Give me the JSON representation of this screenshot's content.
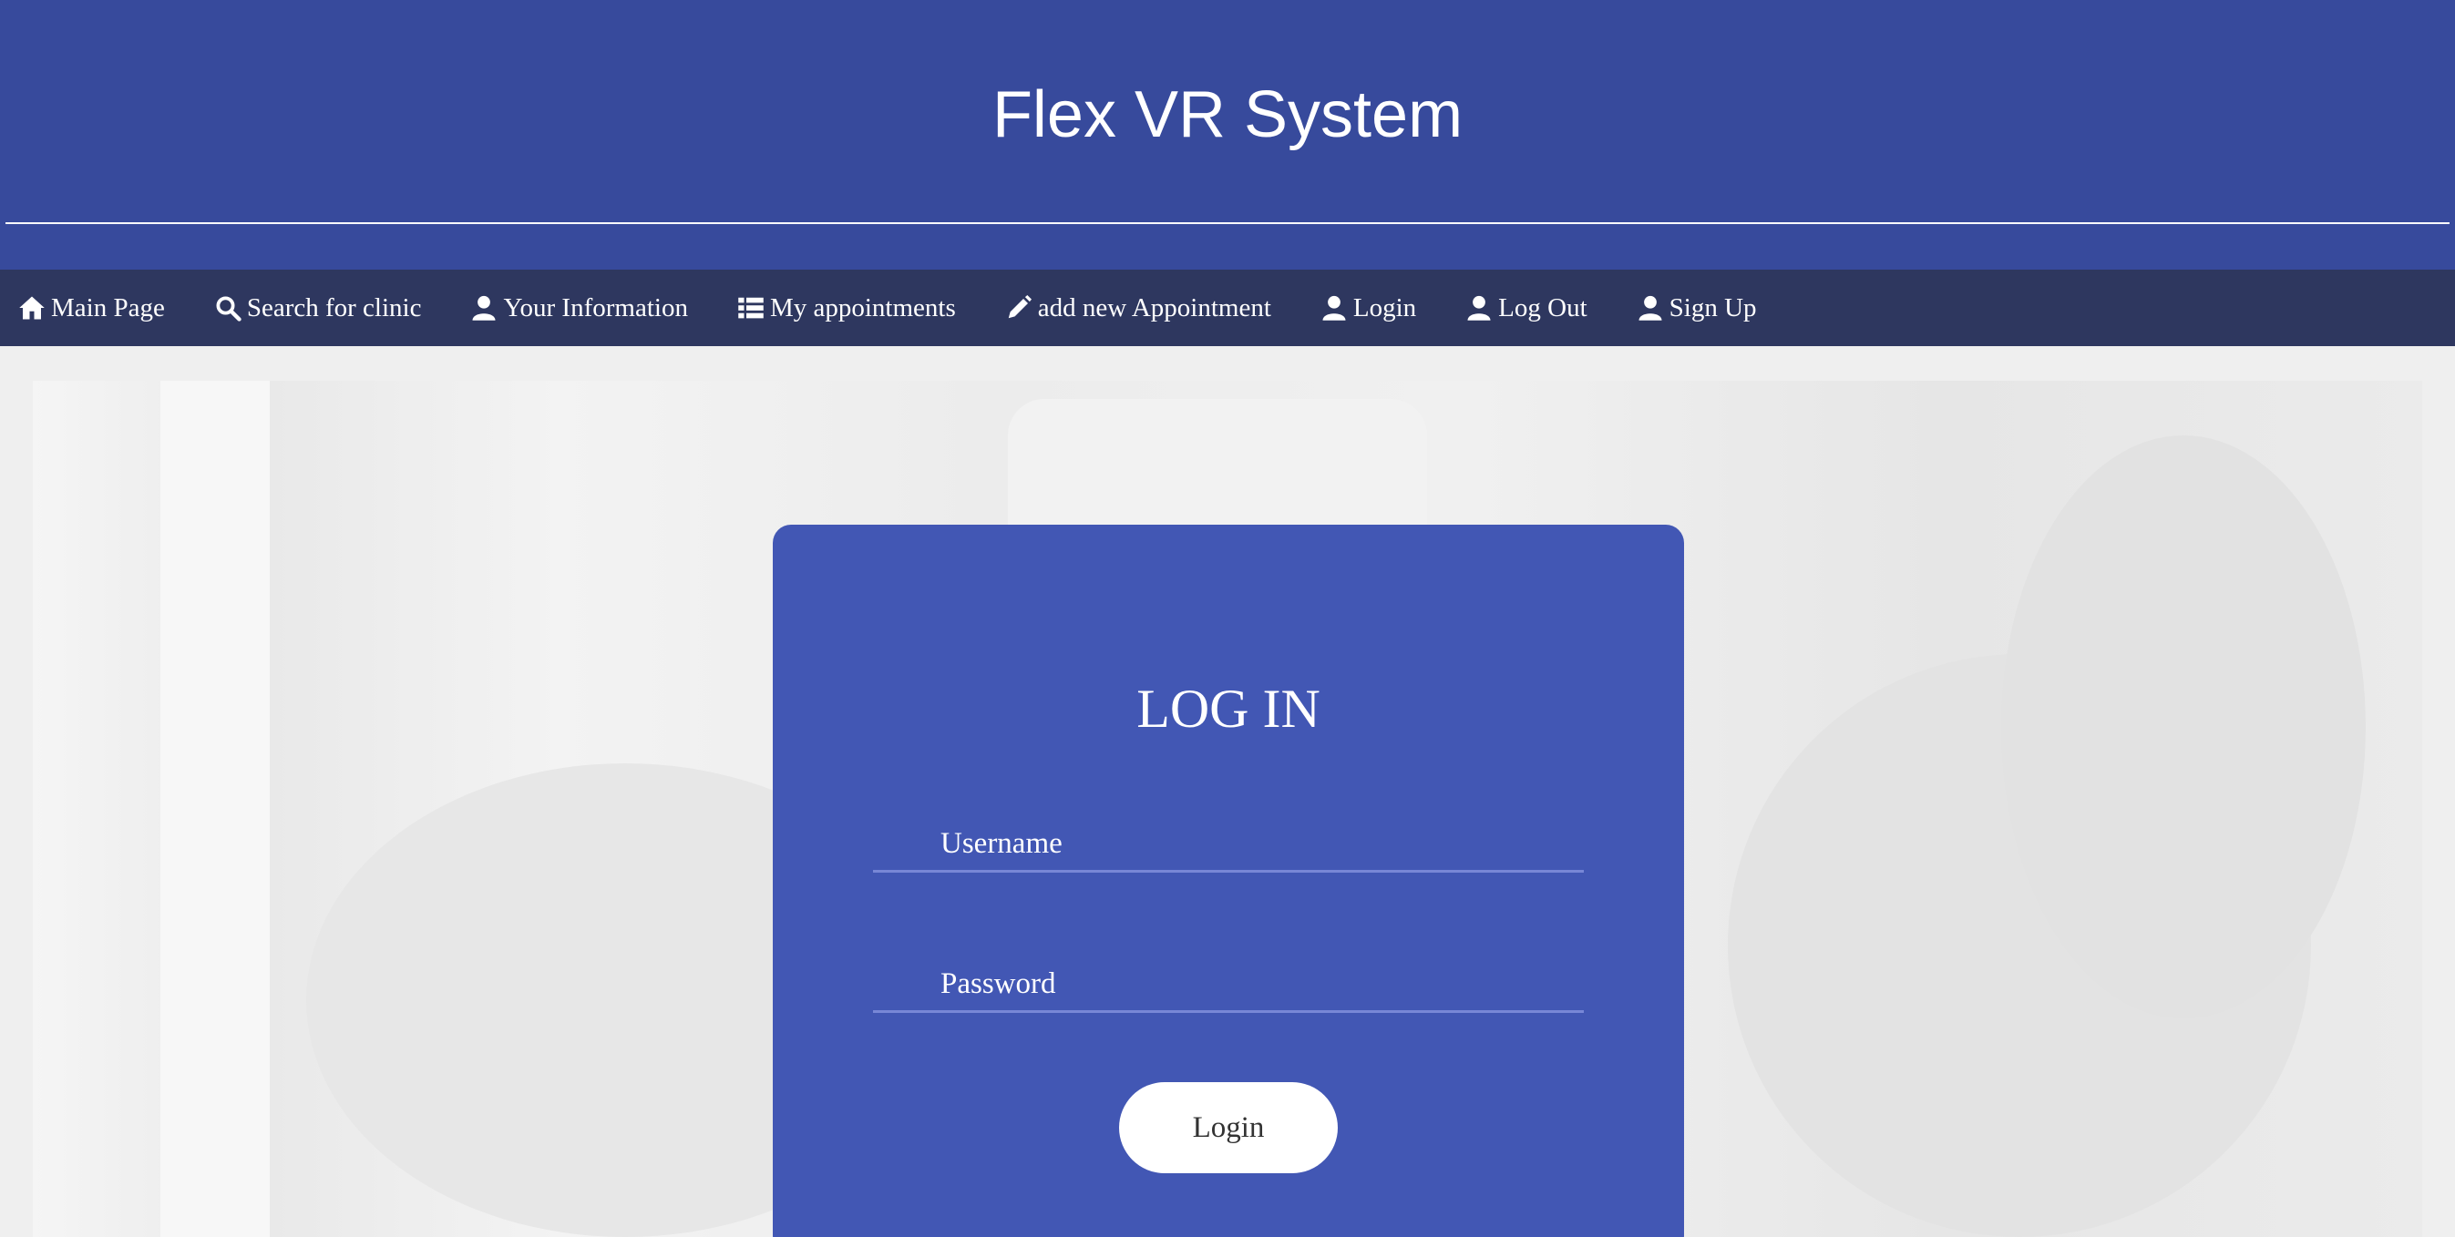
{
  "header": {
    "title": "Flex VR System"
  },
  "nav": {
    "items": [
      {
        "label": "Main Page",
        "icon": "home-icon"
      },
      {
        "label": "Search for clinic",
        "icon": "search-icon"
      },
      {
        "label": "Your Information",
        "icon": "user-icon"
      },
      {
        "label": "My appointments",
        "icon": "list-icon"
      },
      {
        "label": "add new Appointment",
        "icon": "pencil-icon"
      },
      {
        "label": "Login",
        "icon": "user-icon"
      },
      {
        "label": "Log Out",
        "icon": "user-icon"
      },
      {
        "label": "Sign Up",
        "icon": "user-icon"
      }
    ]
  },
  "login": {
    "title": "LOG IN",
    "username_placeholder": "Username",
    "password_placeholder": "Password",
    "button_label": "Login"
  },
  "colors": {
    "header_bg": "#374a9c",
    "nav_bg": "#2e375f",
    "card_bg": "#4257b4"
  }
}
